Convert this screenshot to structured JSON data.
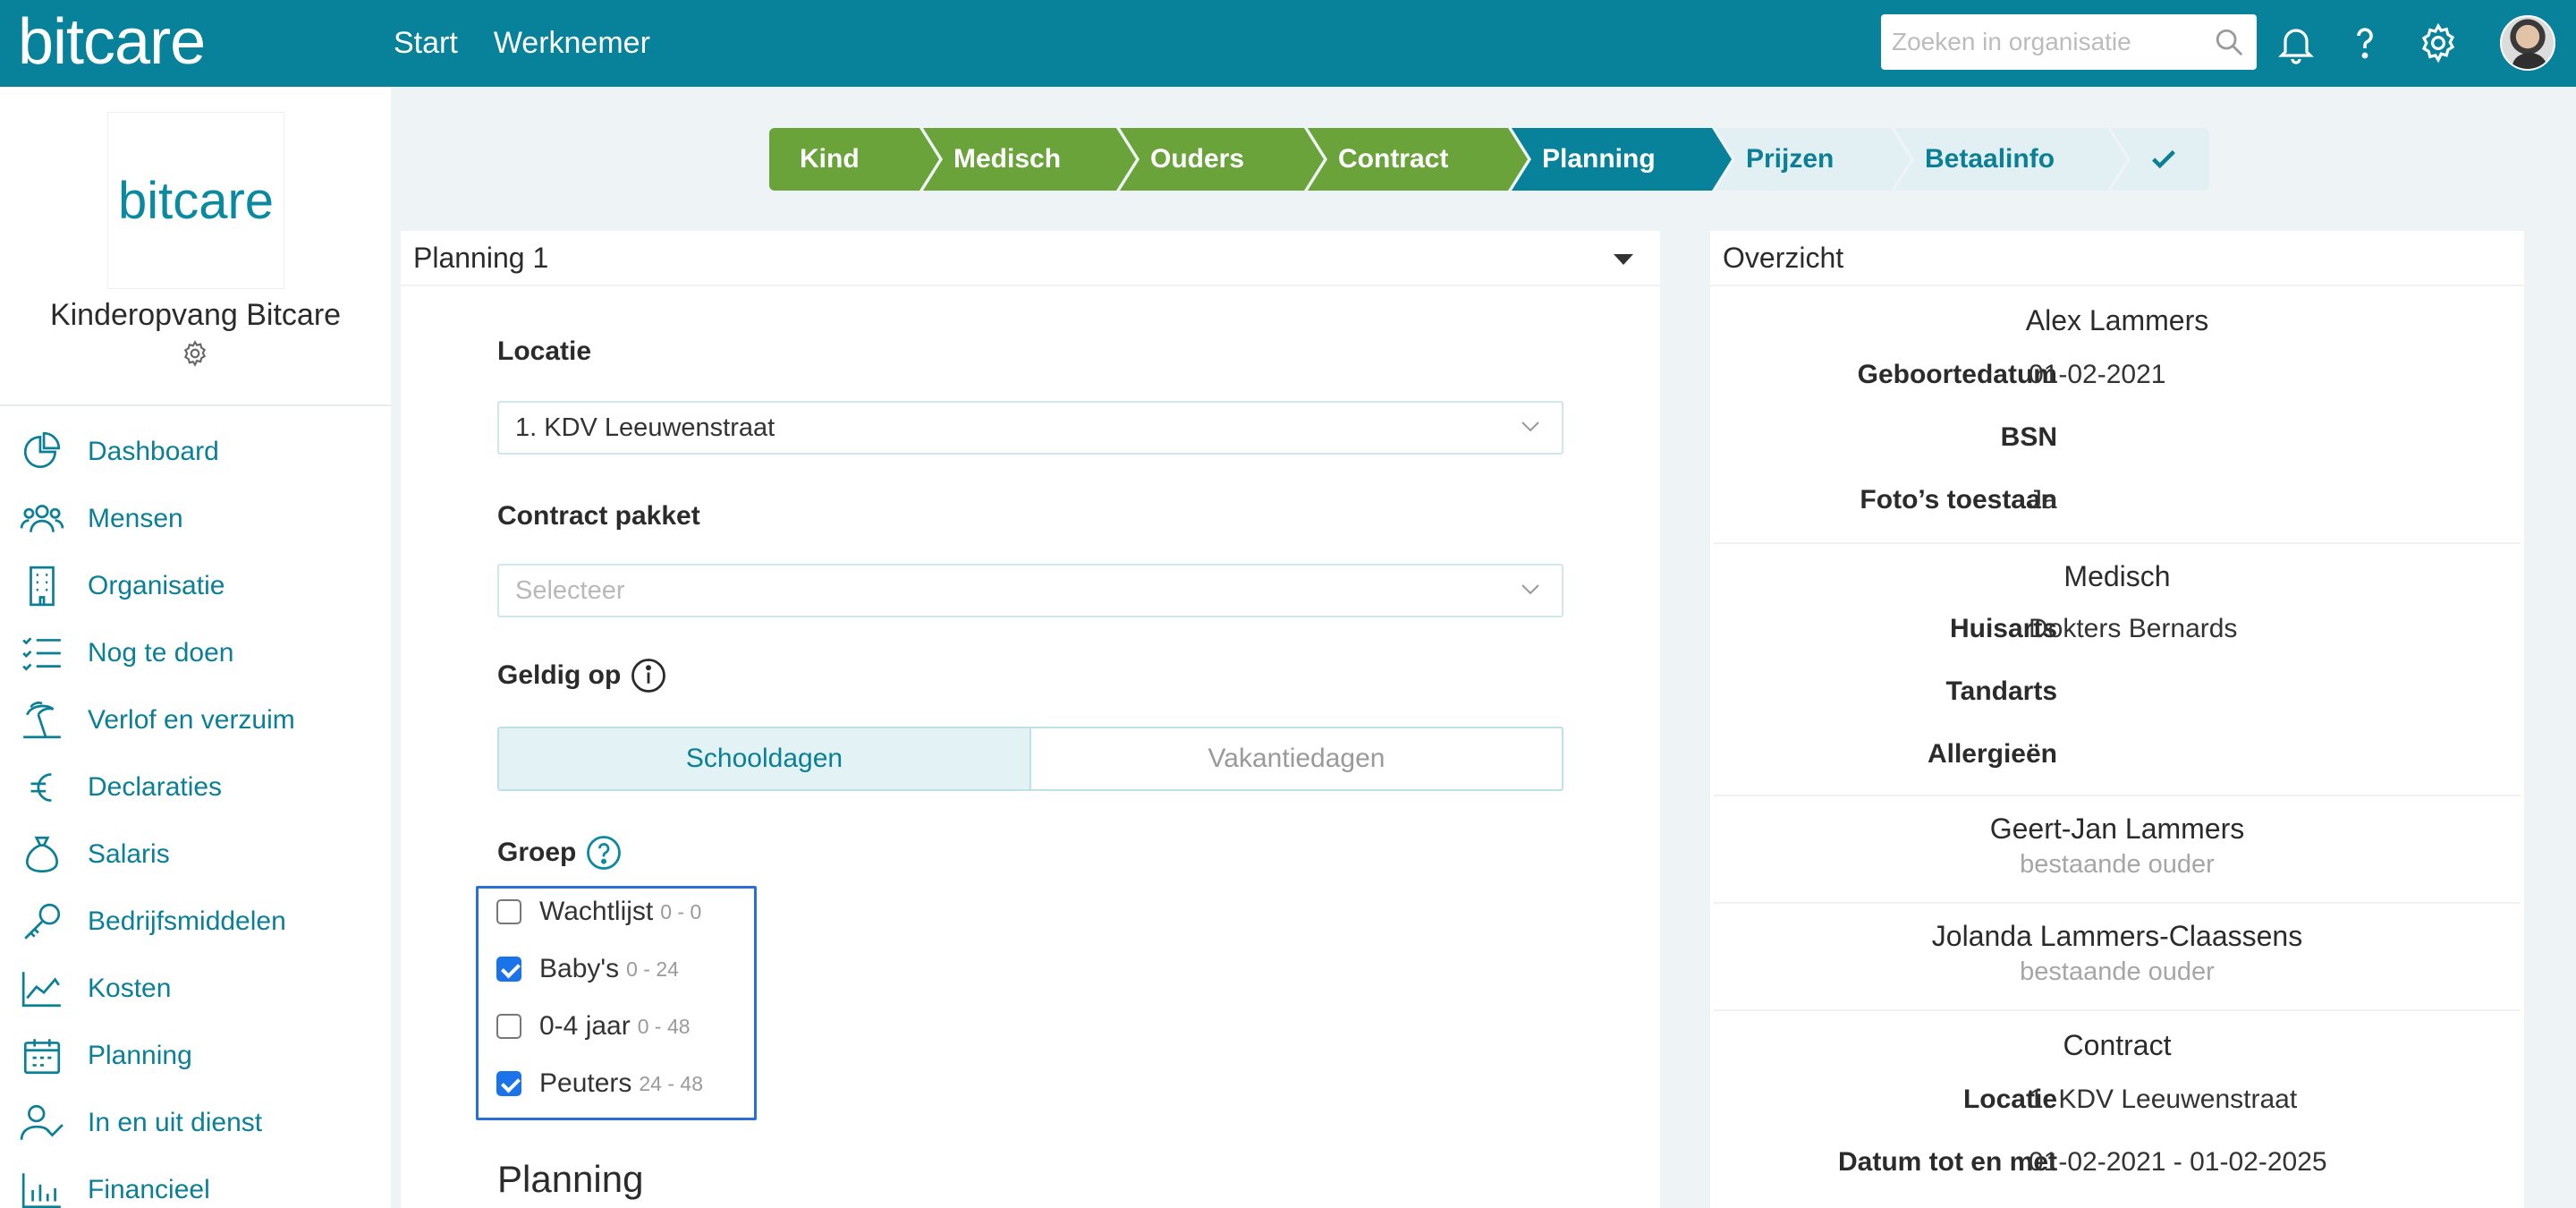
{
  "app": {
    "logo": "bitcare"
  },
  "topnav": {
    "start": "Start",
    "werknemer": "Werknemer"
  },
  "search": {
    "placeholder": "Zoeken in organisatie"
  },
  "icons": {
    "search": "search-icon",
    "bell": "bell-icon",
    "help": "question-icon",
    "settings": "gear-icon"
  },
  "sidebar": {
    "org_logo": "bitcare",
    "org_name": "Kinderopvang Bitcare",
    "items": [
      {
        "label": "Dashboard",
        "icon": "pie-chart-icon"
      },
      {
        "label": "Mensen",
        "icon": "people-icon"
      },
      {
        "label": "Organisatie",
        "icon": "building-icon"
      },
      {
        "label": "Nog te doen",
        "icon": "checklist-icon"
      },
      {
        "label": "Verlof en verzuim",
        "icon": "beach-icon"
      },
      {
        "label": "Declaraties",
        "icon": "euro-icon"
      },
      {
        "label": "Salaris",
        "icon": "money-bag-icon"
      },
      {
        "label": "Bedrijfsmiddelen",
        "icon": "key-icon"
      },
      {
        "label": "Kosten",
        "icon": "area-chart-icon"
      },
      {
        "label": "Planning",
        "icon": "calendar-icon"
      },
      {
        "label": "In en uit dienst",
        "icon": "user-check-icon"
      },
      {
        "label": "Financieel",
        "icon": "bar-chart-icon"
      }
    ]
  },
  "steps": [
    {
      "label": "Kind",
      "state": "done"
    },
    {
      "label": "Medisch",
      "state": "done"
    },
    {
      "label": "Ouders",
      "state": "done"
    },
    {
      "label": "Contract",
      "state": "done"
    },
    {
      "label": "Planning",
      "state": "active"
    },
    {
      "label": "Prijzen",
      "state": "todo"
    },
    {
      "label": "Betaalinfo",
      "state": "todo"
    }
  ],
  "form": {
    "header": "Planning 1",
    "locatie_label": "Locatie",
    "locatie_value": "1. KDV Leeuwenstraat",
    "pakket_label": "Contract pakket",
    "pakket_placeholder": "Selecteer",
    "geldig_label": "Geldig op",
    "toggle_on": "Schooldagen",
    "toggle_off": "Vakantiedagen",
    "groep_label": "Groep",
    "groepen": [
      {
        "name": "Wachtlijst",
        "range": "0 - 0",
        "checked": false
      },
      {
        "name": "Baby's",
        "range": "0 - 24",
        "checked": true
      },
      {
        "name": "0-4 jaar",
        "range": "0 - 48",
        "checked": false
      },
      {
        "name": "Peuters",
        "range": "24 - 48",
        "checked": true
      }
    ],
    "planning_title": "Planning"
  },
  "overview": {
    "header": "Overzicht",
    "child_name": "Alex Lammers",
    "geboortedatum_k": "Geboortedatum",
    "geboortedatum_v": "01-02-2021",
    "bsn_k": "BSN",
    "bsn_v": "",
    "fotos_k": "Foto’s toestaan",
    "fotos_v": "Ja",
    "medisch_head": "Medisch",
    "huisarts_k": "Huisarts",
    "huisarts_v": "Dokters Bernards",
    "tandarts_k": "Tandarts",
    "tandarts_v": "",
    "allergie_k": "Allergieën",
    "allergie_v": "",
    "parent1_name": "Geert-Jan Lammers",
    "parent1_sub": "bestaande ouder",
    "parent2_name": "Jolanda Lammers-Claassens",
    "parent2_sub": "bestaande ouder",
    "contract_head": "Contract",
    "locatie_k": "Locatie",
    "locatie_v": "1. KDV Leeuwenstraat",
    "datum_k": "Datum tot en met",
    "datum_v": "01-02-2021 - 01-02-2025"
  }
}
